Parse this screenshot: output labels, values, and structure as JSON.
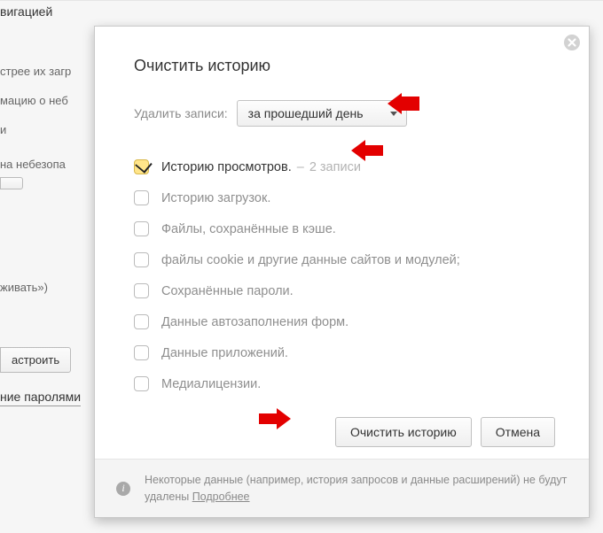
{
  "background": {
    "tab": "вигацией",
    "line1": "стрее их загр",
    "line2": "мацию о неб",
    "line3": "и",
    "line4": "на небезопа",
    "line5": "живать»)",
    "btn_configure": "астроить",
    "link_passwords": "ние паролями"
  },
  "dialog": {
    "title": "Очистить историю",
    "period_label": "Удалить записи:",
    "period_value": "за прошедший день",
    "options": [
      {
        "label": "Историю просмотров.",
        "suffix": "2 записи",
        "checked": true
      },
      {
        "label": "Историю загрузок.",
        "suffix": "",
        "checked": false
      },
      {
        "label": "Файлы, сохранённые в кэше.",
        "suffix": "",
        "checked": false
      },
      {
        "label": "файлы cookie и другие данные сайтов и модулей;",
        "suffix": "",
        "checked": false
      },
      {
        "label": "Сохранённые пароли.",
        "suffix": "",
        "checked": false
      },
      {
        "label": "Данные автозаполнения форм.",
        "suffix": "",
        "checked": false
      },
      {
        "label": "Данные приложений.",
        "suffix": "",
        "checked": false
      },
      {
        "label": "Медиалицензии.",
        "suffix": "",
        "checked": false
      }
    ],
    "submit": "Очистить историю",
    "cancel": "Отмена",
    "footer_text": "Некоторые данные (например, история запросов и данные расширений) не будут удалены ",
    "footer_link": "Подробнее"
  }
}
